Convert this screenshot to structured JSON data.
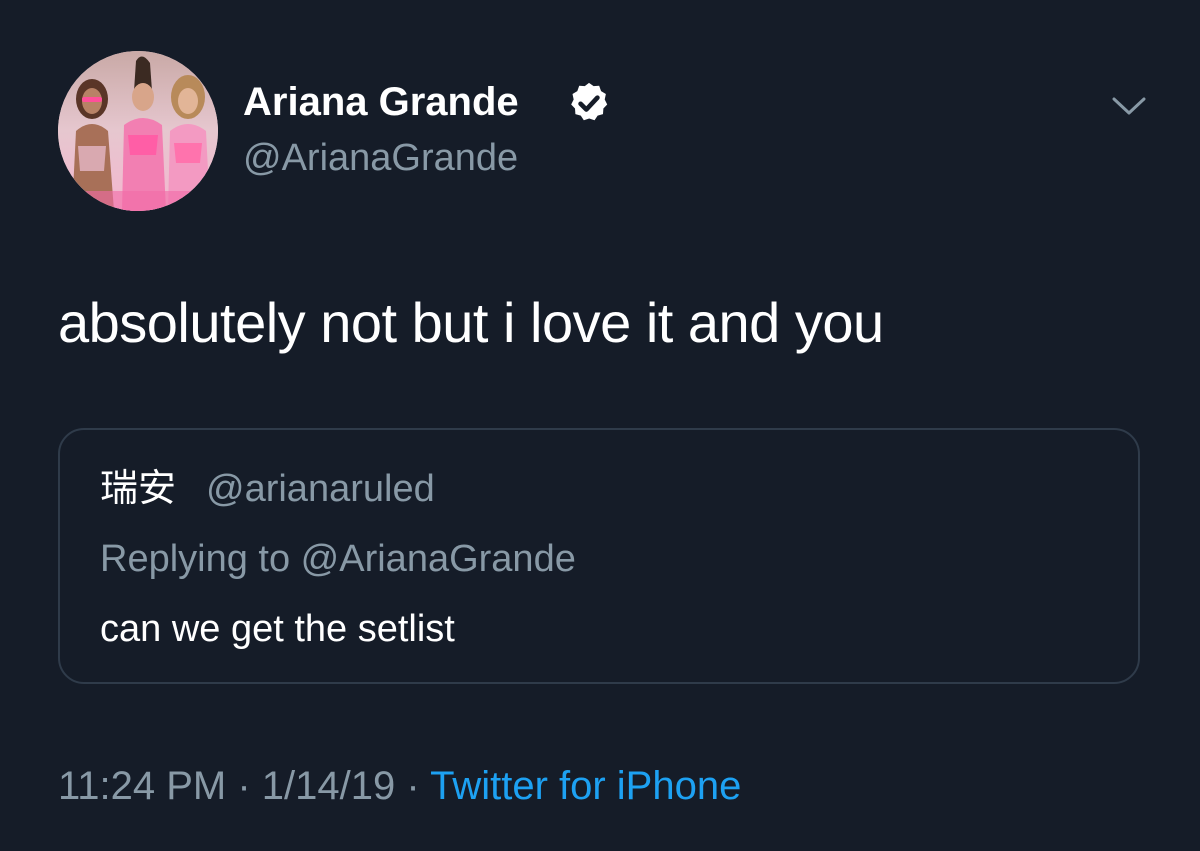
{
  "author": {
    "name": "Ariana Grande",
    "handle": "@ArianaGrande",
    "verified": true,
    "avatar": "profile-photo"
  },
  "tweet": {
    "text": "absolutely not but i love it and you"
  },
  "quoted_tweet": {
    "author_name": "瑞安",
    "handle": "@arianaruled",
    "replying_to": "Replying to @ArianaGrande",
    "text": "can we get the setlist"
  },
  "meta": {
    "time": "11:24 PM",
    "separator": " · ",
    "date": "1/14/19",
    "source": "Twitter for iPhone"
  },
  "icons": {
    "verified": "verified-badge-icon",
    "menu": "chevron-down-icon"
  },
  "colors": {
    "background": "#151c28",
    "primary_text": "#ffffff",
    "secondary_text": "#8899a6",
    "link": "#1da1f2",
    "border": "#2f3b4a"
  }
}
